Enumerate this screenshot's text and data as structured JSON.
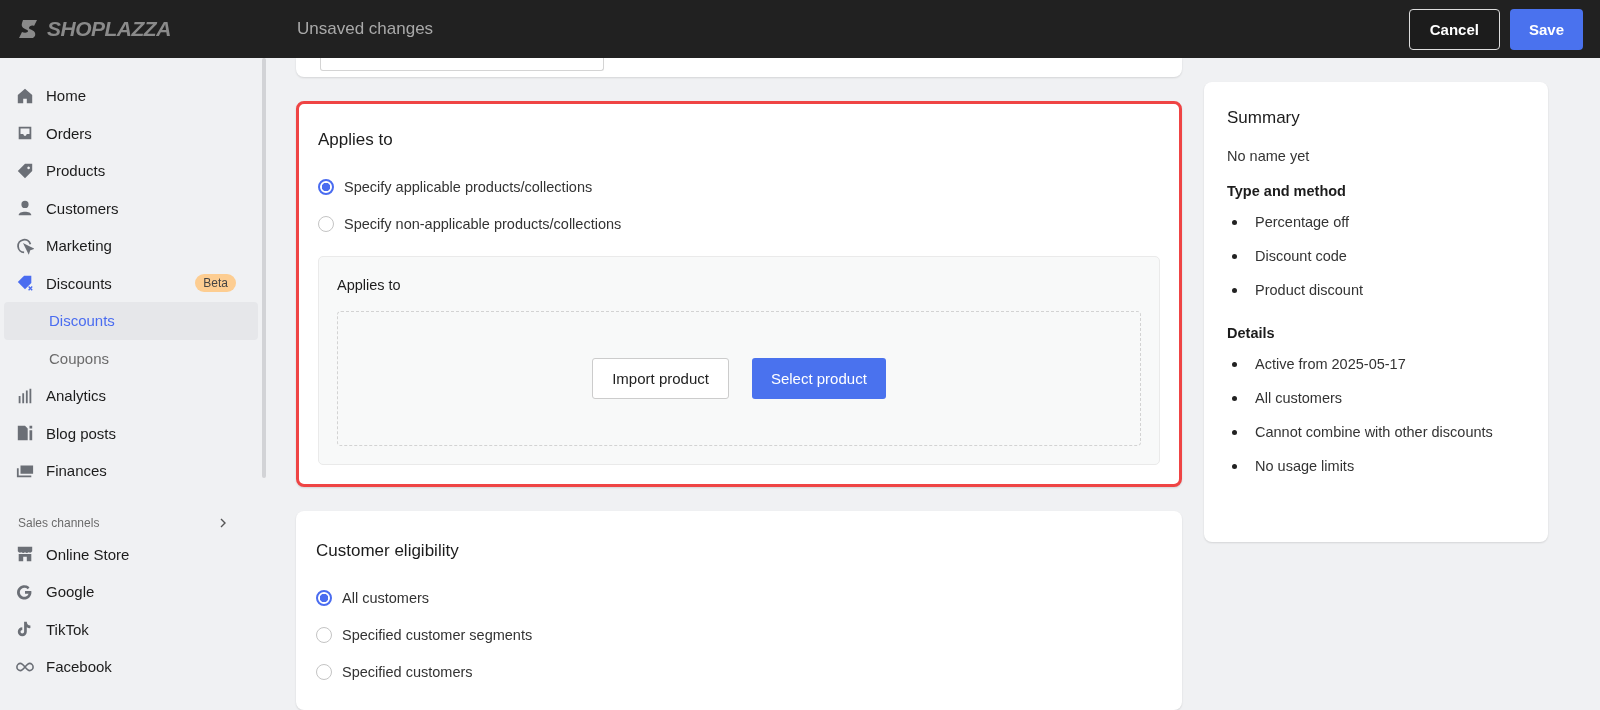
{
  "topbar": {
    "logo": "SHOPLAZZA",
    "title": "Unsaved changes",
    "buttons": [
      {
        "label": "Cancel",
        "kind": "secondary"
      },
      {
        "label": "Save",
        "kind": "primary"
      }
    ]
  },
  "sidebar": {
    "items": [
      {
        "label": "Home",
        "selected": false
      },
      {
        "label": "Orders",
        "selected": false
      },
      {
        "label": "Products",
        "selected": false
      },
      {
        "label": "Customers",
        "selected": false
      },
      {
        "label": "Marketing",
        "selected": false
      },
      {
        "label": "Discounts",
        "selected": false,
        "badge": "Beta",
        "active": true,
        "children": [
          {
            "label": "Discounts",
            "selected": true
          },
          {
            "label": "Coupons",
            "selected": false
          }
        ]
      },
      {
        "label": "Analytics",
        "selected": false
      },
      {
        "label": "Blog posts",
        "selected": false
      },
      {
        "label": "Finances",
        "selected": false
      }
    ],
    "section": "Sales channels",
    "channels": [
      {
        "label": "Online Store",
        "selected": false
      },
      {
        "label": "Google",
        "selected": false
      },
      {
        "label": "TikTok",
        "selected": false
      },
      {
        "label": "Facebook",
        "selected": false
      }
    ]
  },
  "applies_card": {
    "title": "Applies to",
    "highlighted": true,
    "options": [
      {
        "label": "Specify applicable products/collections",
        "selected": true
      },
      {
        "label": "Specify non-applicable products/collections",
        "selected": false
      }
    ],
    "panel": {
      "title": "Applies to",
      "buttons": [
        {
          "label": "Import product",
          "kind": "secondary"
        },
        {
          "label": "Select product",
          "kind": "primary"
        }
      ]
    }
  },
  "eligibility_card": {
    "title": "Customer eligibility",
    "options": [
      {
        "label": "All customers",
        "selected": true
      },
      {
        "label": "Specified customer segments",
        "selected": false
      },
      {
        "label": "Specified customers",
        "selected": false
      }
    ]
  },
  "summary": {
    "title": "Summary",
    "name": "No name yet",
    "sections": [
      {
        "heading": "Type and method",
        "items": [
          "Percentage off",
          "Discount code",
          "Product discount"
        ]
      },
      {
        "heading": "Details",
        "items": [
          "Active from 2025-05-17",
          "All customers",
          "Cannot combine with other discounts",
          "No usage limits"
        ]
      }
    ]
  }
}
